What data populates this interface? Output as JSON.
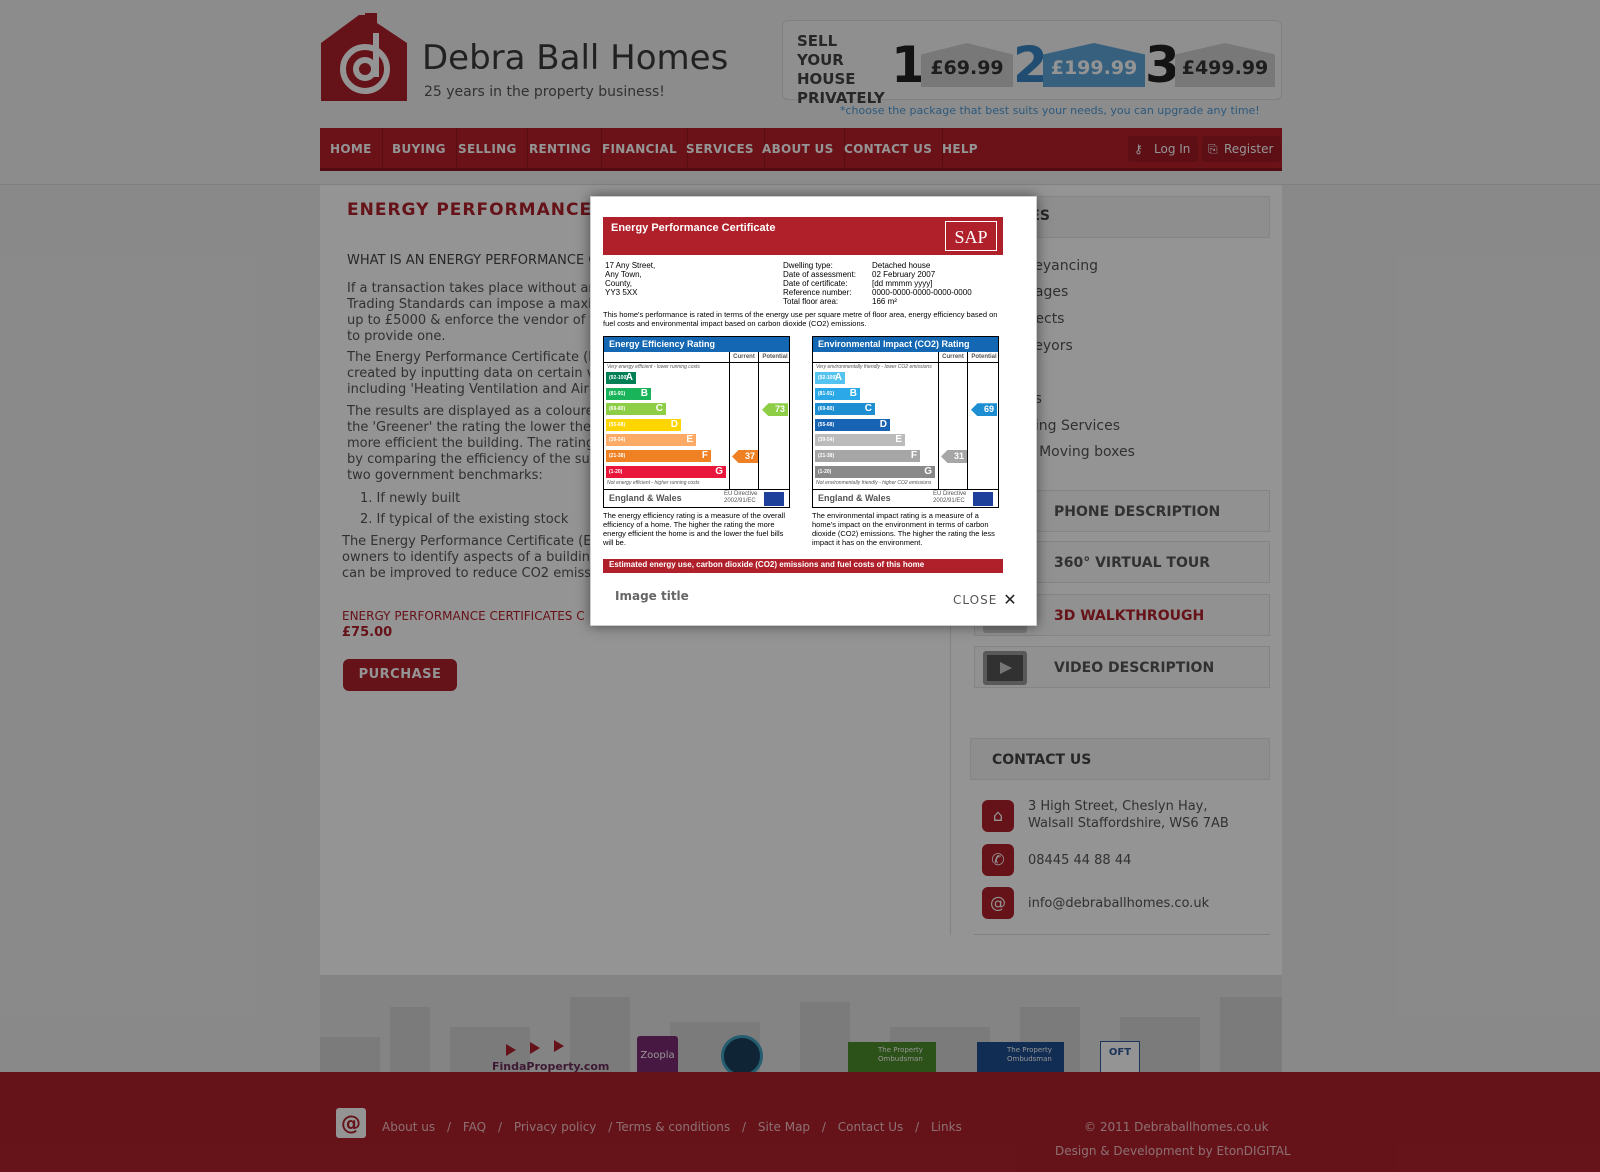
{
  "brand": {
    "name": "Debra Ball Homes",
    "tagline": "25 years in the property business!",
    "logo_glyph": "@"
  },
  "sell": {
    "text": "SELL YOUR HOUSE PRIVATELY",
    "packages": [
      {
        "num": "1",
        "price": "£69.99"
      },
      {
        "num": "2",
        "price": "£199.99"
      },
      {
        "num": "3",
        "price": "£499.99"
      }
    ],
    "note": "*choose the package that best suits your needs, you can upgrade any time!"
  },
  "nav": {
    "items": [
      "HOME",
      "BUYING",
      "SELLING",
      "RENTING",
      "FINANCIAL",
      "SERVICES",
      "ABOUT US",
      "CONTACT US",
      "HELP"
    ],
    "login": "Log In",
    "register": "Register"
  },
  "main": {
    "title": "ENERGY PERFORMANCE CER",
    "question": "WHAT IS AN ENERGY PERFORMANCE CE",
    "paragraphs": [
      "If a transaction takes place without an\nTrading Standards can impose a maxim\nup to £5000 & enforce the vendor of th\nto provide one.",
      "The Energy Performance Certificate (EP\ncreated by inputting data on certain va\nincluding 'Heating Ventilation and Air C",
      "The results are displayed as a coloured\nthe 'Greener' the rating the lower the s\nmore efficient the building.  The rating\nby comparing the efficiency of the subj\ntwo government benchmarks:"
    ],
    "list": [
      "1. If newly built",
      "2. If typical of the existing stock"
    ],
    "paragraph_after": "The Energy Performance Certificate (EP\nowners to identify aspects of a building\ncan be improved to reduce CO2 emissio",
    "product_name": "ENERGY PERFORMANCE CERTIFICATES C",
    "price": "£75.00",
    "purchase": "PURCHASE"
  },
  "sidebar": {
    "services_title": "CES",
    "services": [
      "veyancing",
      "gages",
      "itects",
      "veyors",
      "s",
      "es",
      "ning Services",
      "e Moving boxes"
    ],
    "features": [
      {
        "label": "PHONE DESCRIPTION"
      },
      {
        "label": "360° VIRTUAL TOUR"
      },
      {
        "label": "3D WALKTHROUGH"
      },
      {
        "label": "VIDEO DESCRIPTION"
      }
    ],
    "contact_title": "CONTACT US",
    "address": "3 High Street, Cheslyn Hay,\nWalsall Staffordshire, WS6 7AB",
    "phone": "08445 44 88 44",
    "email": "info@debraballhomes.co.uk"
  },
  "partners": [
    "FindaProperty.com",
    "Zoopla",
    "The Property Ombudsman",
    "The Property Ombudsman",
    "OFT"
  ],
  "footer": {
    "links": [
      "About us",
      "/",
      "FAQ",
      "/",
      "Privacy policy",
      "/ Terms & conditions",
      "/",
      "Site Map",
      "/",
      "Contact Us",
      "/",
      "Links"
    ],
    "copyright": "© 2011 Debraballhomes.co.uk",
    "credit": "Design & Development by EtonDIGITAL"
  },
  "modal": {
    "caption": "Image title",
    "close": "CLOSE",
    "epc": {
      "title": "Energy Performance Certificate",
      "sap": "SAP",
      "address": [
        "17 Any Street,",
        "Any Town,",
        "County,",
        "YY3 5XX"
      ],
      "details_labels": [
        "Dwelling type:",
        "Date of assessment:",
        "Date of certificate:",
        "Reference number:",
        "Total floor area:"
      ],
      "details_values": [
        "Detached house",
        "02 February 2007",
        "[dd mmmm yyyy]",
        "0000-0000-0000-0000-0000",
        "166 m²"
      ],
      "intro": "This home's performance is rated in terms of the energy use per square metre of floor area, energy efficiency based on fuel costs and environmental impact based on carbon dioxide (CO2) emissions.",
      "ee_title": "Energy Efficiency Rating",
      "ei_title": "Environmental Impact (CO2) Rating",
      "col_current": "Current",
      "col_potential": "Potential",
      "ee_top": "Very energy efficient - lower running costs",
      "ee_bottom": "Not energy efficient - higher running costs",
      "ei_top": "Very environmentally friendly - lower CO2 emissions",
      "ei_bottom": "Not environmentally friendly - higher CO2 emissions",
      "bands": [
        {
          "range": "(92-100)",
          "letter": "A"
        },
        {
          "range": "(81-91)",
          "letter": "B"
        },
        {
          "range": "(69-80)",
          "letter": "C"
        },
        {
          "range": "(55-68)",
          "letter": "D"
        },
        {
          "range": "(39-54)",
          "letter": "E"
        },
        {
          "range": "(21-38)",
          "letter": "F"
        },
        {
          "range": "(1-20)",
          "letter": "G"
        }
      ],
      "ee_colors": [
        "#008054",
        "#19b459",
        "#8dce46",
        "#ffd500",
        "#fcaa65",
        "#ef8023",
        "#e9153b"
      ],
      "ei_colors": [
        "#55c3f0",
        "#2aa8e8",
        "#1d8ed2",
        "#1864b4",
        "#bbbbbb",
        "#a6a6a6",
        "#898989"
      ],
      "ee_current": "37",
      "ee_potential": "73",
      "ei_current": "31",
      "ei_potential": "69",
      "region": "England & Wales",
      "directive": "EU Directive\n2002/91/EC",
      "ee_desc": "The energy efficiency rating is a measure of the overall efficiency of a home. The higher the rating the more energy efficient the home is and the lower the fuel bills will be.",
      "ei_desc": "The environmental impact rating is a measure of a home's impact on the environment in terms of carbon dioxide (CO2) emissions. The higher the rating the less impact it has on the environment.",
      "footer_bar": "Estimated energy use, carbon dioxide (CO2) emissions and fuel costs of this home"
    }
  }
}
